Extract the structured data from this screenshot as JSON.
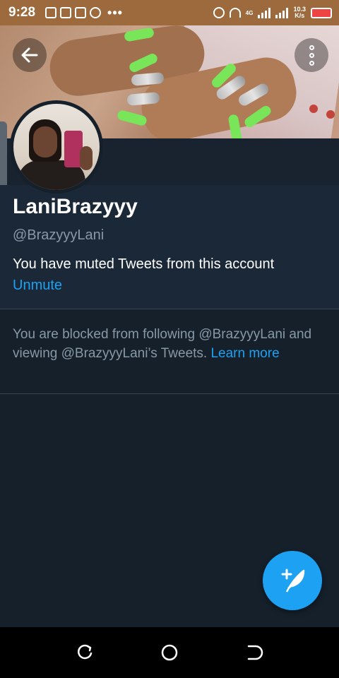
{
  "status_bar": {
    "time": "9:28",
    "overflow_dots": "•••",
    "network_type": "4G",
    "net_speed_value": "10.3",
    "net_speed_unit": "K/s",
    "accent_color": "#9c6a3c"
  },
  "header": {
    "back_icon": "arrow-left-icon",
    "more_icon": "more-vertical-icon"
  },
  "profile": {
    "display_name": "LaniBrazyyy",
    "handle": "@BrazyyyLani",
    "muted_message": "You have muted Tweets from this account",
    "unmute_label": "Unmute"
  },
  "blocked_notice": {
    "text": "You are blocked from following @BrazyyyLani and viewing @BrazyyyLani’s Tweets. ",
    "learn_more_label": "Learn more"
  },
  "fab": {
    "icon": "compose-tweet-icon"
  },
  "colors": {
    "background": "#15202b",
    "profile_background": "#1b2838",
    "link": "#1da1f2",
    "secondary_text": "#8899a6"
  }
}
